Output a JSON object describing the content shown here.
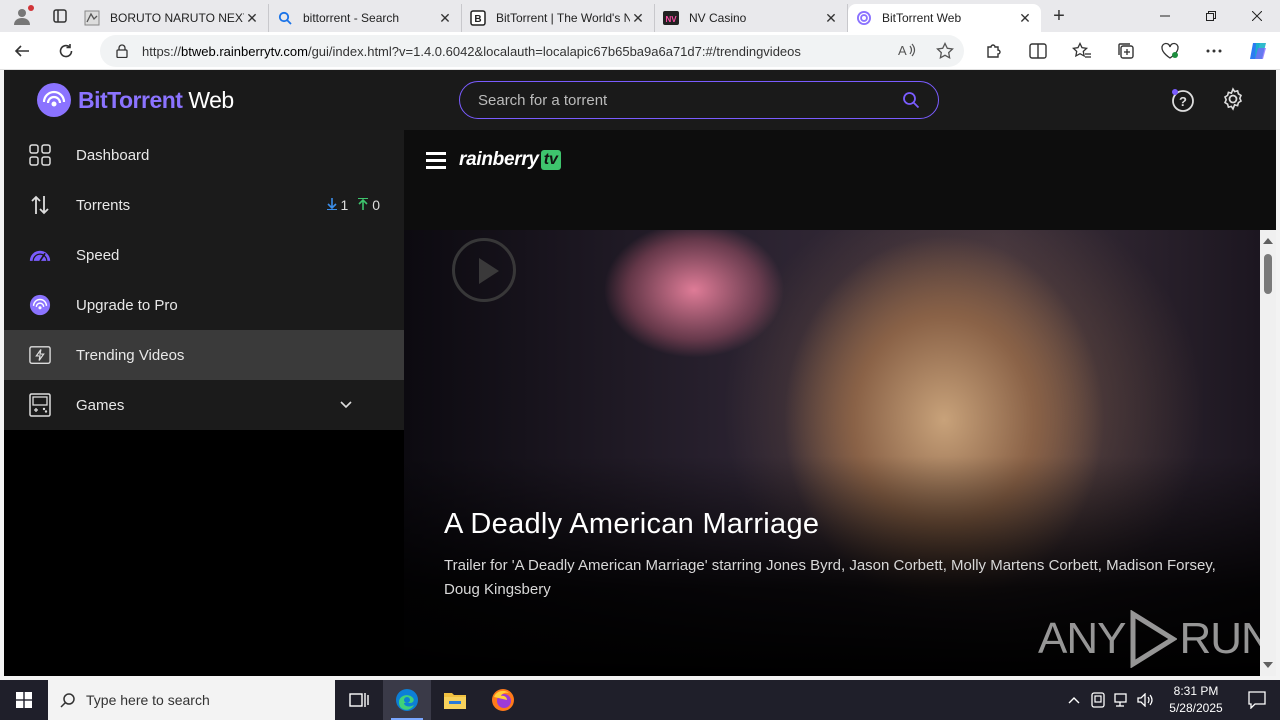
{
  "browser": {
    "tabs": [
      {
        "title": "BORUTO NARUTO NEXT G",
        "favicon": "boruto-icon"
      },
      {
        "title": "bittorrent - Search",
        "favicon": "search-icon"
      },
      {
        "title": "BitTorrent | The World's N",
        "favicon": "bittorrent-b-icon"
      },
      {
        "title": "NV Casino",
        "favicon": "nv-casino-icon"
      },
      {
        "title": "BitTorrent Web",
        "favicon": "bittorrent-web-icon"
      }
    ],
    "active_tab": 4,
    "url_prefix": "https://",
    "url_host": "btweb.rainberrytv.com",
    "url_rest": "/gui/index.html?v=1.4.0.6042&localauth=localapic67b65ba9a6a71d7:#/trendingvideos"
  },
  "app": {
    "logo_brand": "BitTorrent",
    "logo_suffix": " Web",
    "search_placeholder": "Search for a torrent",
    "nav": [
      {
        "label": "Dashboard",
        "icon": "dashboard-grid-icon"
      },
      {
        "label": "Torrents",
        "icon": "up-down-arrows-icon",
        "down_count": "1",
        "up_count": "0"
      },
      {
        "label": "Speed",
        "icon": "speedometer-icon"
      },
      {
        "label": "Upgrade to Pro",
        "icon": "bittorrent-logo-icon"
      },
      {
        "label": "Trending Videos",
        "icon": "lightning-video-icon",
        "active": true
      },
      {
        "label": "Games",
        "icon": "gameboy-icon",
        "expandable": true
      }
    ],
    "rainberry": {
      "text": "rainberry",
      "badge": "tv"
    },
    "video": {
      "title": "A Deadly American Marriage",
      "description": "Trailer for 'A Deadly American Marriage' starring Jones Byrd, Jason Corbett, Molly Martens Corbett, Madison Forsey, Doug Kingsbery"
    },
    "watermark": {
      "left": "ANY",
      "right": "RUN"
    }
  },
  "taskbar": {
    "search_placeholder": "Type here to search",
    "time": "8:31 PM",
    "date": "5/28/2025"
  },
  "colors": {
    "accent": "#7a5cff",
    "download_arrow": "#3b8eea",
    "upload_arrow": "#3ec46d"
  }
}
